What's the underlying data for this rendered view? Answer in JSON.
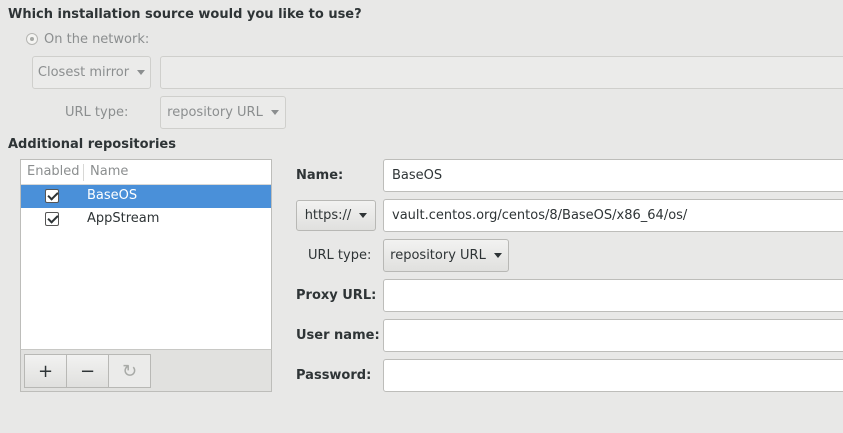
{
  "source_question": "Which installation source would you like to use?",
  "network_option": {
    "label": "On the network:",
    "mirror_label": "Closest mirror",
    "url_type_label": "URL type:",
    "url_type_value": "repository URL"
  },
  "additional_repos": {
    "title": "Additional repositories",
    "columns": [
      "Enabled",
      "Name"
    ],
    "repos": [
      {
        "name": "BaseOS",
        "enabled": true,
        "selected": true
      },
      {
        "name": "AppStream",
        "enabled": true,
        "selected": false
      }
    ],
    "toolbar": {
      "add": "+",
      "remove": "−",
      "reset": "↻"
    }
  },
  "repo_details": {
    "name_label": "Name:",
    "name_value": "BaseOS",
    "protocol": "https://",
    "url_value": "vault.centos.org/centos/8/BaseOS/x86_64/os/",
    "url_type_label": "URL type:",
    "url_type_value": "repository URL",
    "proxy_label": "Proxy URL:",
    "proxy_value": "",
    "user_label": "User name:",
    "user_value": "",
    "password_label": "Password:",
    "password_value": ""
  },
  "colors": {
    "selection": "#4a90d9",
    "background": "#e8e8e7"
  }
}
